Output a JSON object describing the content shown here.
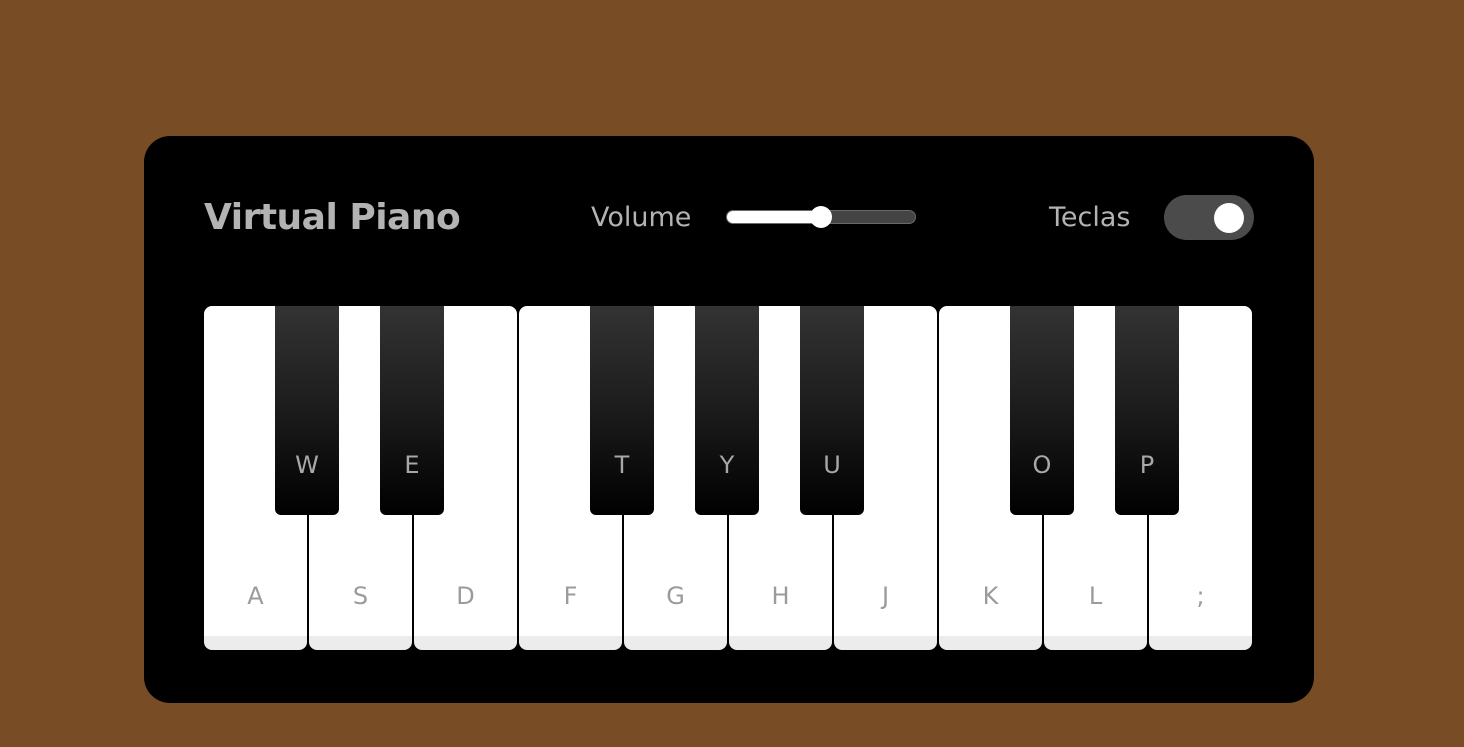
{
  "header": {
    "title": "Virtual Piano",
    "volume_label": "Volume",
    "keys_label": "Teclas"
  },
  "volume": {
    "value": 0.5
  },
  "show_keys": {
    "on": true
  },
  "keyboard": {
    "white_keys": [
      "A",
      "S",
      "D",
      "F",
      "G",
      "H",
      "J",
      "K",
      "L",
      ";"
    ],
    "black_keys": [
      "W",
      "E",
      "T",
      "Y",
      "U",
      "O",
      "P"
    ]
  },
  "colors": {
    "page_background": "#784c24",
    "panel_background": "#000000",
    "title_text": "#b3b3b3",
    "white_key": "#ffffff",
    "black_key": "#000000",
    "toggle_track": "#4b4b4b"
  }
}
